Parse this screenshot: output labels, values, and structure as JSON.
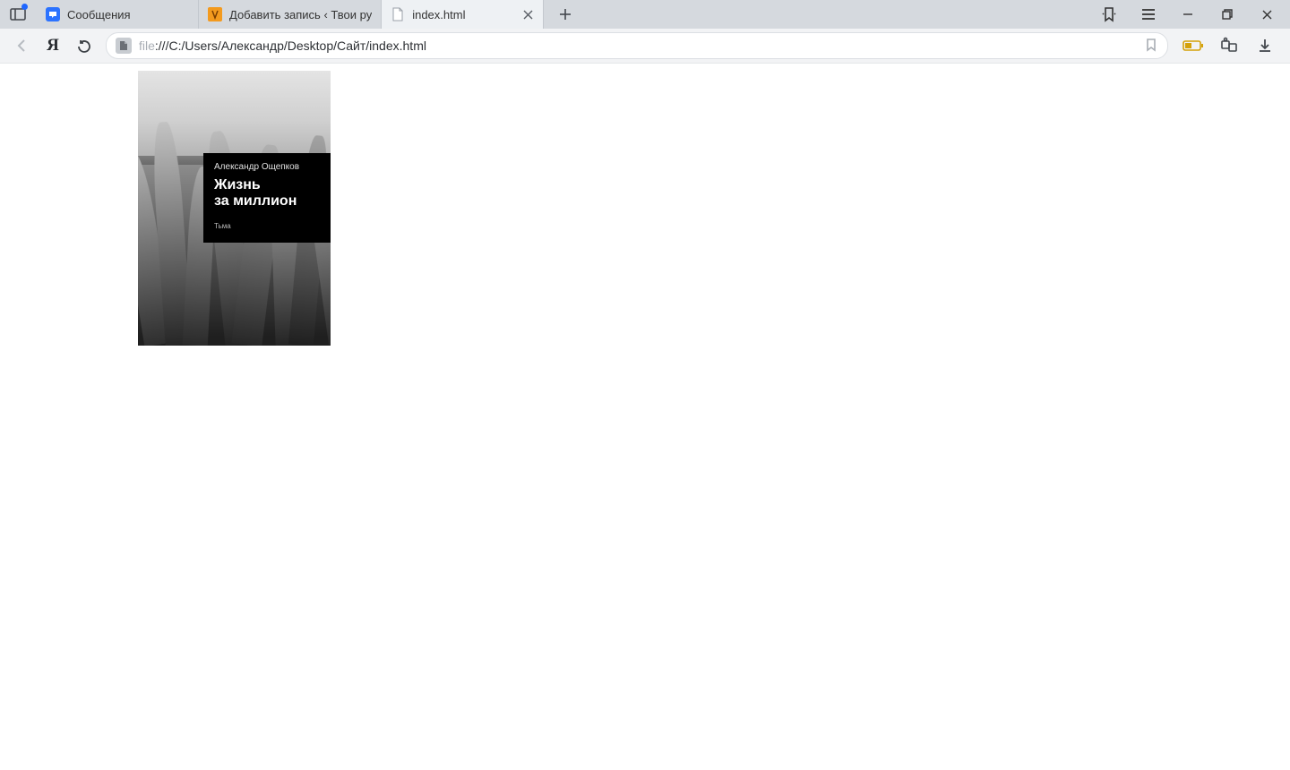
{
  "tabs": [
    {
      "label": "Сообщения",
      "active": false,
      "closable": false,
      "icon": "chat-icon"
    },
    {
      "label": "Добавить запись ‹ Твои ру",
      "active": false,
      "closable": false,
      "icon": "wordpress-icon"
    },
    {
      "label": "index.html",
      "active": true,
      "closable": true,
      "icon": "file-icon"
    }
  ],
  "address": {
    "protocol": "file",
    "rest": ":///C:/Users/Александр/Desktop/Сайт/index.html"
  },
  "book": {
    "author": "Александр Ощепков",
    "title_line1": "Жизнь",
    "title_line2": "за миллион",
    "subtitle": "Тьма"
  }
}
